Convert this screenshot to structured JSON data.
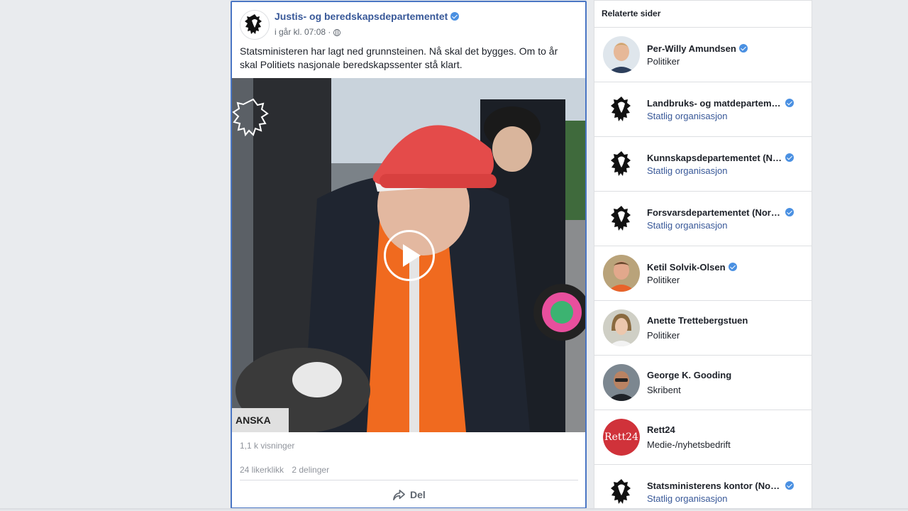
{
  "post": {
    "page_name": "Justis- og beredskapsdepartementet",
    "time": "i går kl. 07:08 ·",
    "text": "Statsministeren har lagt ned grunnsteinen. Nå skal det bygges. Om to år skal Politiets nasjonale beredskapssenter stå klart.",
    "views": "1,1 k visninger",
    "likes": "24 likerklikk",
    "shares": "2 delinger",
    "share_label": "Del",
    "video_overlay_text": "ANSKA"
  },
  "related": {
    "title": "Relaterte sider",
    "items": [
      {
        "name": "Per-Willy Amundsen",
        "category": "Politiker",
        "verified": true,
        "category_link": false,
        "avatar": "person-light"
      },
      {
        "name": "Landbruks- og matdepartementet",
        "category": "Statlig organisasjon",
        "verified": true,
        "category_link": true,
        "avatar": "lion-crest"
      },
      {
        "name": "Kunnskapsdepartementet (Norway)",
        "category": "Statlig organisasjon",
        "verified": true,
        "category_link": true,
        "avatar": "lion-crest"
      },
      {
        "name": "Forsvarsdepartementet (Norway)",
        "category": "Statlig organisasjon",
        "verified": true,
        "category_link": true,
        "avatar": "lion-crest"
      },
      {
        "name": "Ketil Solvik-Olsen",
        "category": "Politiker",
        "verified": true,
        "category_link": false,
        "avatar": "person-orange"
      },
      {
        "name": "Anette Trettebergstuen",
        "category": "Politiker",
        "verified": false,
        "category_link": false,
        "avatar": "person-woman"
      },
      {
        "name": "George K. Gooding",
        "category": "Skribent",
        "verified": false,
        "category_link": false,
        "avatar": "person-dark"
      },
      {
        "name": "Rett24",
        "category": "Medie-/nyhetsbedrift",
        "verified": false,
        "category_link": false,
        "avatar": "rett24-logo",
        "logo_text": "Rett24"
      },
      {
        "name": "Statsministerens kontor (Norway)",
        "category": "Statlig organisasjon",
        "verified": true,
        "category_link": true,
        "avatar": "lion-crest"
      }
    ]
  },
  "colors": {
    "background": "#e9ebee",
    "link_blue": "#385898",
    "verified_blue": "#4a90e2",
    "focus_border": "#4a76c4",
    "rett24_red": "#d0323a"
  }
}
